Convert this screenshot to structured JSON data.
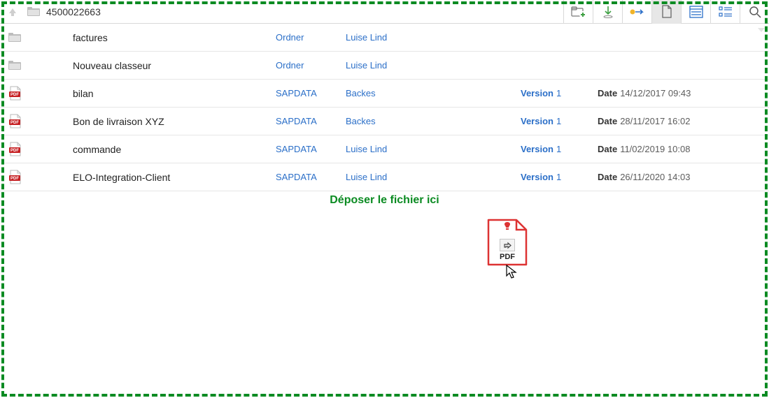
{
  "header": {
    "title": "4500022663"
  },
  "drop_text": "Déposer le fichier ici",
  "labels": {
    "version": "Version",
    "date": "Date"
  },
  "drag_ghost": {
    "label": "PDF"
  },
  "rows": [
    {
      "kind": "folder",
      "name": "factures",
      "type": "Ordner",
      "owner": "Luise Lind",
      "version": "",
      "date": ""
    },
    {
      "kind": "folder",
      "name": "Nouveau classeur",
      "type": "Ordner",
      "owner": "Luise Lind",
      "version": "",
      "date": ""
    },
    {
      "kind": "pdf",
      "name": "bilan",
      "type": "SAPDATA",
      "owner": "Backes",
      "version": "1",
      "date": "14/12/2017 09:43"
    },
    {
      "kind": "pdf",
      "name": "Bon de livraison XYZ",
      "type": "SAPDATA",
      "owner": "Backes",
      "version": "1",
      "date": "28/11/2017 16:02"
    },
    {
      "kind": "pdf",
      "name": "commande",
      "type": "SAPDATA",
      "owner": "Luise Lind",
      "version": "1",
      "date": "11/02/2019 10:08"
    },
    {
      "kind": "pdf",
      "name": "ELO-Integration-Client",
      "type": "SAPDATA",
      "owner": "Luise Lind",
      "version": "1",
      "date": "26/11/2020 14:03"
    }
  ]
}
